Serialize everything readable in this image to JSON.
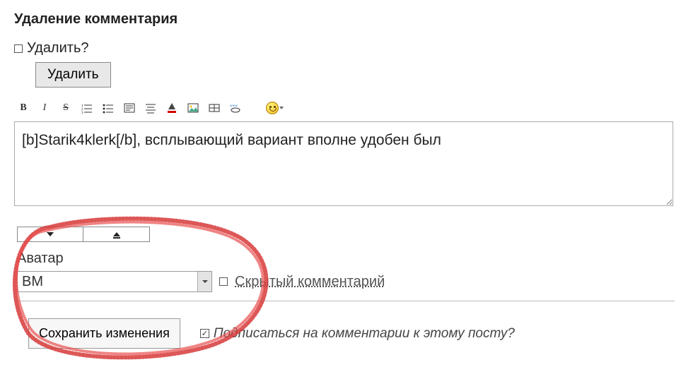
{
  "title": "Удаление комментария",
  "delete": {
    "question": "Удалить?",
    "button": "Удалить",
    "checked": false
  },
  "toolbar": {
    "icons": [
      "bold",
      "italic",
      "strike",
      "ol",
      "ul",
      "quote",
      "align",
      "color",
      "image",
      "table",
      "link",
      "smiley"
    ]
  },
  "editor": {
    "value": "[b]Starik4klerk[/b], всплывающий вариант вполне удобен был"
  },
  "avatar": {
    "label": "Аватар",
    "selected": "ВМ"
  },
  "hidden_comment": {
    "label": "Скрытый комментарий",
    "checked": false
  },
  "save": {
    "button": "Сохранить изменения"
  },
  "subscribe": {
    "label": "Подписаться на комментарии к этому посту?",
    "checked": true
  }
}
